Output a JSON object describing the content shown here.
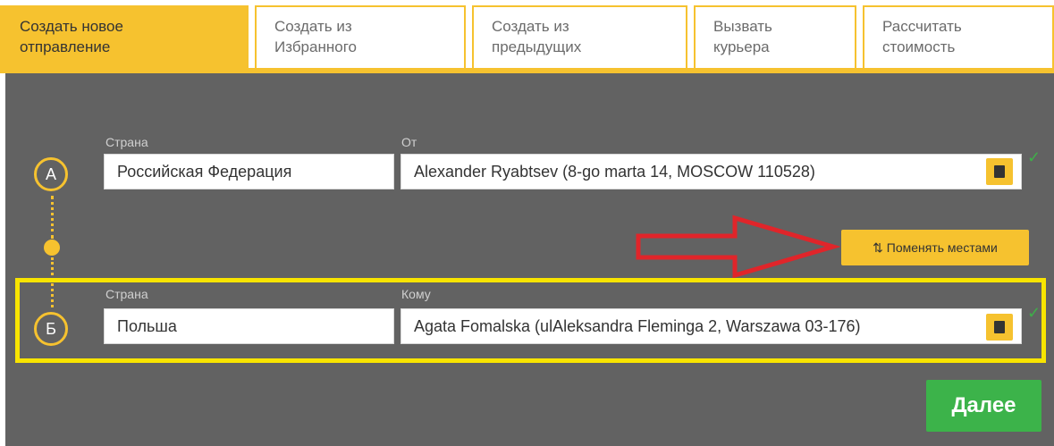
{
  "tabs": [
    {
      "line1": "Создать новое",
      "line2": "отправление"
    },
    {
      "line1": "Создать из",
      "line2": "Избранного"
    },
    {
      "line1": "Создать из",
      "line2": "предыдущих"
    },
    {
      "line1": "Вызвать",
      "line2": "курьера"
    },
    {
      "line1": "Рассчитать",
      "line2": "стоимость"
    }
  ],
  "sender": {
    "marker": "А",
    "country_label": "Страна",
    "country_value": "Российская Федерация",
    "from_label": "От",
    "from_value": "Alexander Ryabtsev (8-go marta 14, MOSCOW 110528)"
  },
  "recipient": {
    "marker": "Б",
    "country_label": "Страна",
    "country_value": "Польша",
    "to_label": "Кому",
    "to_value": "Agata Fomalska (ulAleksandra Fleminga 2, Warszawa 03-176)"
  },
  "swap_button": {
    "icon": "swap-arrows-icon",
    "label": "Поменять местами"
  },
  "next_button": {
    "label": "Далее"
  },
  "colors": {
    "accent": "#f6c22f",
    "panel": "#626262",
    "next": "#3cb34a",
    "highlight": "#f8e400",
    "arrow": "#e0252a"
  }
}
